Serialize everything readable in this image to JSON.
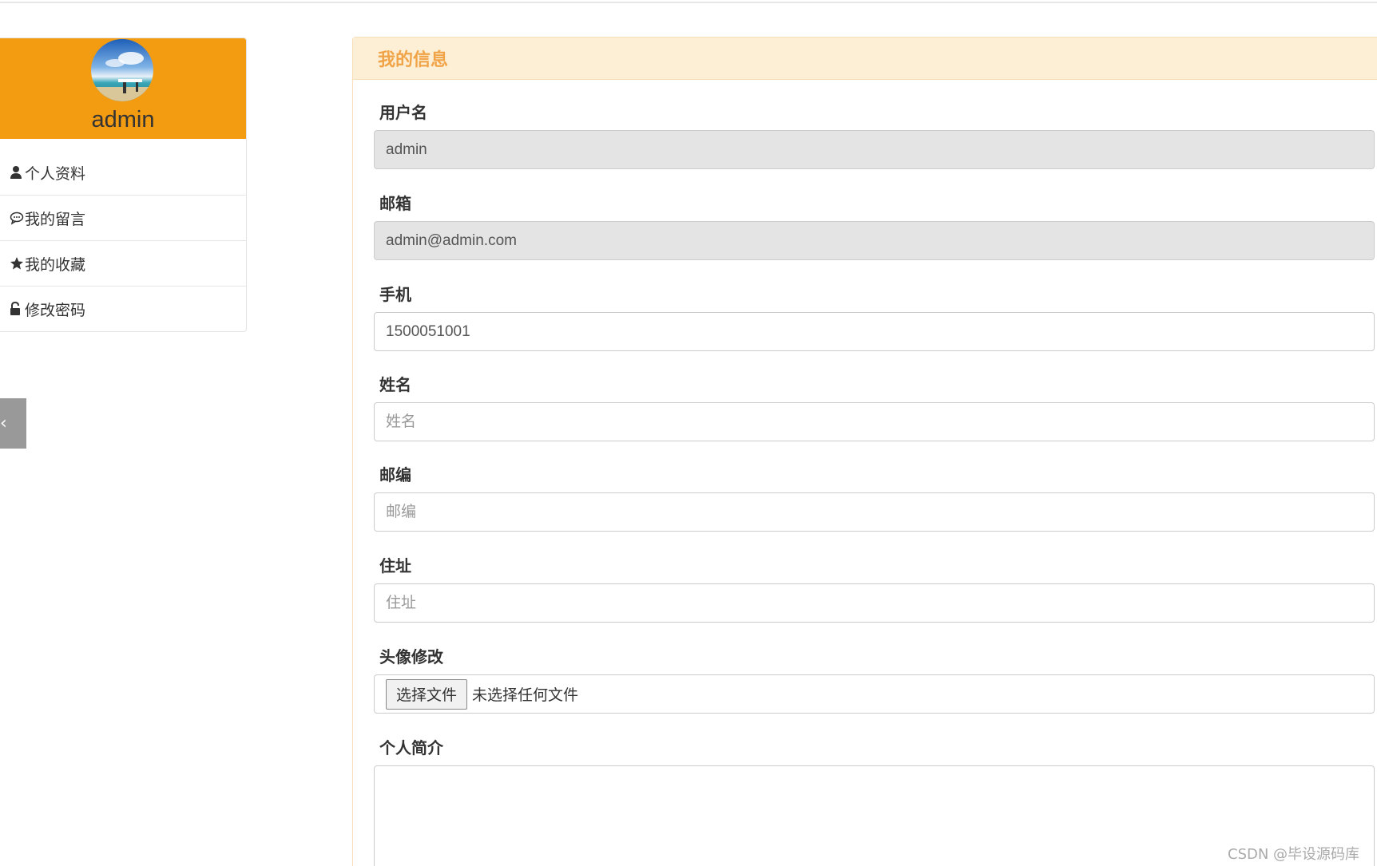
{
  "sidebar": {
    "username": "admin",
    "menu": [
      {
        "icon": "user-icon",
        "label": "个人资料"
      },
      {
        "icon": "comment-icon",
        "label": "我的留言"
      },
      {
        "icon": "star-icon",
        "label": "我的收藏"
      },
      {
        "icon": "lock-icon",
        "label": "修改密码"
      }
    ],
    "accent_color": "#f39c12"
  },
  "panel": {
    "title": "我的信息",
    "title_color": "#f0a447",
    "heading_bg": "#fdeed6"
  },
  "form": {
    "username": {
      "label": "用户名",
      "value": "admin"
    },
    "email": {
      "label": "邮箱",
      "value": "admin@admin.com"
    },
    "phone": {
      "label": "手机",
      "value": "1500051001"
    },
    "name": {
      "label": "姓名",
      "placeholder": "姓名"
    },
    "zipcode": {
      "label": "邮编",
      "placeholder": "邮编"
    },
    "address": {
      "label": "住址",
      "placeholder": "住址"
    },
    "avatar": {
      "label": "头像修改",
      "button": "选择文件",
      "status": "未选择任何文件"
    },
    "bio": {
      "label": "个人简介",
      "value": ""
    }
  },
  "watermark": "CSDN @毕设源码库"
}
